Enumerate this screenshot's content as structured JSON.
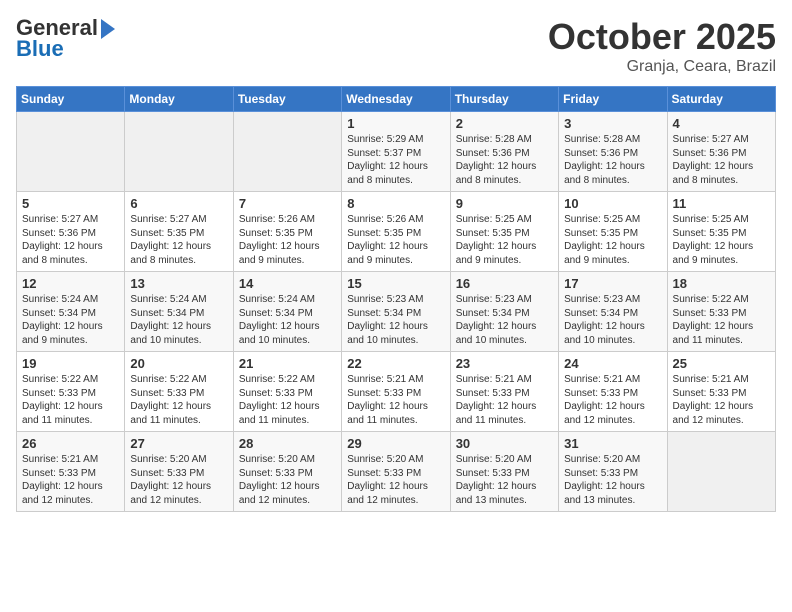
{
  "header": {
    "logo_general": "General",
    "logo_blue": "Blue",
    "month": "October 2025",
    "location": "Granja, Ceara, Brazil"
  },
  "weekdays": [
    "Sunday",
    "Monday",
    "Tuesday",
    "Wednesday",
    "Thursday",
    "Friday",
    "Saturday"
  ],
  "weeks": [
    [
      {
        "day": "",
        "info": ""
      },
      {
        "day": "",
        "info": ""
      },
      {
        "day": "",
        "info": ""
      },
      {
        "day": "1",
        "info": "Sunrise: 5:29 AM\nSunset: 5:37 PM\nDaylight: 12 hours\nand 8 minutes."
      },
      {
        "day": "2",
        "info": "Sunrise: 5:28 AM\nSunset: 5:36 PM\nDaylight: 12 hours\nand 8 minutes."
      },
      {
        "day": "3",
        "info": "Sunrise: 5:28 AM\nSunset: 5:36 PM\nDaylight: 12 hours\nand 8 minutes."
      },
      {
        "day": "4",
        "info": "Sunrise: 5:27 AM\nSunset: 5:36 PM\nDaylight: 12 hours\nand 8 minutes."
      }
    ],
    [
      {
        "day": "5",
        "info": "Sunrise: 5:27 AM\nSunset: 5:36 PM\nDaylight: 12 hours\nand 8 minutes."
      },
      {
        "day": "6",
        "info": "Sunrise: 5:27 AM\nSunset: 5:35 PM\nDaylight: 12 hours\nand 8 minutes."
      },
      {
        "day": "7",
        "info": "Sunrise: 5:26 AM\nSunset: 5:35 PM\nDaylight: 12 hours\nand 9 minutes."
      },
      {
        "day": "8",
        "info": "Sunrise: 5:26 AM\nSunset: 5:35 PM\nDaylight: 12 hours\nand 9 minutes."
      },
      {
        "day": "9",
        "info": "Sunrise: 5:25 AM\nSunset: 5:35 PM\nDaylight: 12 hours\nand 9 minutes."
      },
      {
        "day": "10",
        "info": "Sunrise: 5:25 AM\nSunset: 5:35 PM\nDaylight: 12 hours\nand 9 minutes."
      },
      {
        "day": "11",
        "info": "Sunrise: 5:25 AM\nSunset: 5:35 PM\nDaylight: 12 hours\nand 9 minutes."
      }
    ],
    [
      {
        "day": "12",
        "info": "Sunrise: 5:24 AM\nSunset: 5:34 PM\nDaylight: 12 hours\nand 9 minutes."
      },
      {
        "day": "13",
        "info": "Sunrise: 5:24 AM\nSunset: 5:34 PM\nDaylight: 12 hours\nand 10 minutes."
      },
      {
        "day": "14",
        "info": "Sunrise: 5:24 AM\nSunset: 5:34 PM\nDaylight: 12 hours\nand 10 minutes."
      },
      {
        "day": "15",
        "info": "Sunrise: 5:23 AM\nSunset: 5:34 PM\nDaylight: 12 hours\nand 10 minutes."
      },
      {
        "day": "16",
        "info": "Sunrise: 5:23 AM\nSunset: 5:34 PM\nDaylight: 12 hours\nand 10 minutes."
      },
      {
        "day": "17",
        "info": "Sunrise: 5:23 AM\nSunset: 5:34 PM\nDaylight: 12 hours\nand 10 minutes."
      },
      {
        "day": "18",
        "info": "Sunrise: 5:22 AM\nSunset: 5:33 PM\nDaylight: 12 hours\nand 11 minutes."
      }
    ],
    [
      {
        "day": "19",
        "info": "Sunrise: 5:22 AM\nSunset: 5:33 PM\nDaylight: 12 hours\nand 11 minutes."
      },
      {
        "day": "20",
        "info": "Sunrise: 5:22 AM\nSunset: 5:33 PM\nDaylight: 12 hours\nand 11 minutes."
      },
      {
        "day": "21",
        "info": "Sunrise: 5:22 AM\nSunset: 5:33 PM\nDaylight: 12 hours\nand 11 minutes."
      },
      {
        "day": "22",
        "info": "Sunrise: 5:21 AM\nSunset: 5:33 PM\nDaylight: 12 hours\nand 11 minutes."
      },
      {
        "day": "23",
        "info": "Sunrise: 5:21 AM\nSunset: 5:33 PM\nDaylight: 12 hours\nand 11 minutes."
      },
      {
        "day": "24",
        "info": "Sunrise: 5:21 AM\nSunset: 5:33 PM\nDaylight: 12 hours\nand 12 minutes."
      },
      {
        "day": "25",
        "info": "Sunrise: 5:21 AM\nSunset: 5:33 PM\nDaylight: 12 hours\nand 12 minutes."
      }
    ],
    [
      {
        "day": "26",
        "info": "Sunrise: 5:21 AM\nSunset: 5:33 PM\nDaylight: 12 hours\nand 12 minutes."
      },
      {
        "day": "27",
        "info": "Sunrise: 5:20 AM\nSunset: 5:33 PM\nDaylight: 12 hours\nand 12 minutes."
      },
      {
        "day": "28",
        "info": "Sunrise: 5:20 AM\nSunset: 5:33 PM\nDaylight: 12 hours\nand 12 minutes."
      },
      {
        "day": "29",
        "info": "Sunrise: 5:20 AM\nSunset: 5:33 PM\nDaylight: 12 hours\nand 12 minutes."
      },
      {
        "day": "30",
        "info": "Sunrise: 5:20 AM\nSunset: 5:33 PM\nDaylight: 12 hours\nand 13 minutes."
      },
      {
        "day": "31",
        "info": "Sunrise: 5:20 AM\nSunset: 5:33 PM\nDaylight: 12 hours\nand 13 minutes."
      },
      {
        "day": "",
        "info": ""
      }
    ]
  ]
}
